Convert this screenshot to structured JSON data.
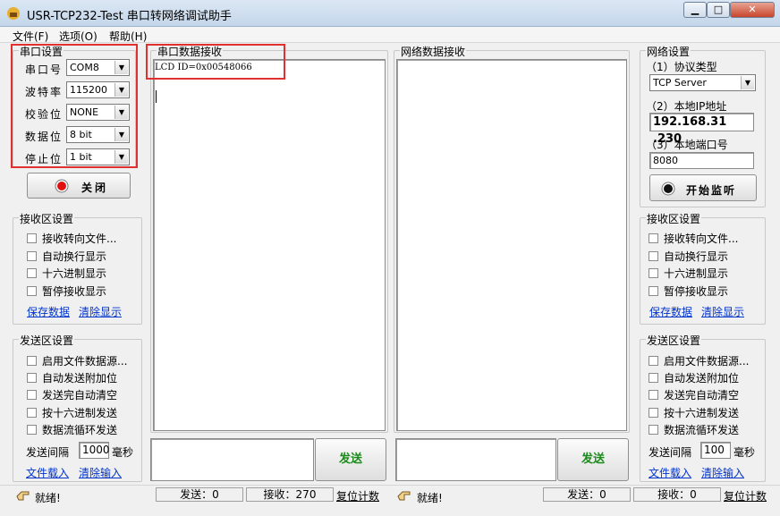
{
  "window": {
    "title": "USR-TCP232-Test 串口转网络调试助手",
    "min": "▁",
    "max": "□",
    "close": "✕"
  },
  "menu": [
    "文件(F)",
    "选项(O)",
    "帮助(H)"
  ],
  "serial": {
    "group_title": "串口设置",
    "port_label": "串口号",
    "port_value": "COM8",
    "baud_label": "波特率",
    "baud_value": "115200",
    "parity_label": "校验位",
    "parity_value": "NONE",
    "databits_label": "数据位",
    "databits_value": "8 bit",
    "stopbits_label": "停止位",
    "stopbits_value": "1 bit",
    "close_button": "关闭"
  },
  "left_recv": {
    "group_title": "接收区设置",
    "options": [
      "接收转向文件...",
      "自动换行显示",
      "十六进制显示",
      "暂停接收显示"
    ],
    "save_link": "保存数据",
    "clear_link": "清除显示"
  },
  "left_send": {
    "group_title": "发送区设置",
    "options": [
      "启用文件数据源...",
      "自动发送附加位",
      "发送完自动清空",
      "按十六进制发送",
      "数据流循环发送"
    ],
    "interval_label": "发送间隔",
    "interval_value": "1000",
    "interval_unit": "毫秒",
    "load_link": "文件载入",
    "clear_link": "清除输入"
  },
  "serial_recv": {
    "title": "串口数据接收",
    "content": "LCD ID=0x00548066"
  },
  "net_recv": {
    "title": "网络数据接收",
    "content": ""
  },
  "send_button_left": "发送",
  "send_button_right": "发送",
  "network": {
    "group_title": "网络设置",
    "protocol_label": "（1）协议类型",
    "protocol_value": "TCP Server",
    "ip_label": "（2）本地IP地址",
    "ip_value": "192.168.31 .230",
    "port_label": "（3）本地端口号",
    "port_value": "8080",
    "listen_button": "开始监听"
  },
  "right_recv": {
    "group_title": "接收区设置",
    "options": [
      "接收转向文件...",
      "自动换行显示",
      "十六进制显示",
      "暂停接收显示"
    ],
    "save_link": "保存数据",
    "clear_link": "清除显示"
  },
  "right_send": {
    "group_title": "发送区设置",
    "options": [
      "启用文件数据源...",
      "自动发送附加位",
      "发送完自动清空",
      "按十六进制发送",
      "数据流循环发送"
    ],
    "interval_label": "发送间隔",
    "interval_value": "100",
    "interval_unit": "毫秒",
    "load_link": "文件载入",
    "clear_link": "清除输入"
  },
  "status_left": {
    "ready": "就绪!",
    "sent": "发送：0",
    "recv": "接收：270",
    "reset": "复位计数"
  },
  "status_right": {
    "ready": "就绪!",
    "sent": "发送：0",
    "recv": "接收：0",
    "reset": "复位计数"
  },
  "colors": {
    "highlight": "#e03030",
    "send_text": "#1a8a1a",
    "link": "#0033cc"
  }
}
